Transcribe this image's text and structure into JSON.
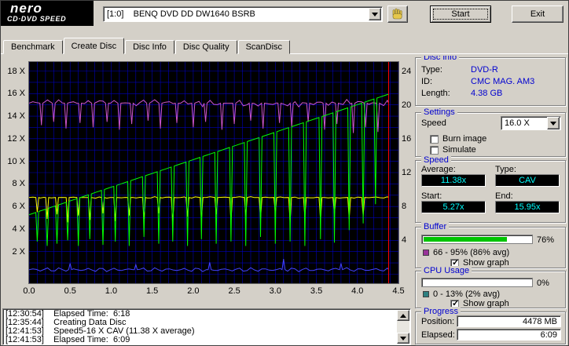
{
  "logo": {
    "brand": "nero",
    "product": "CD·DVD SPEED"
  },
  "toolbar": {
    "drive": "[1:0]    BENQ DVD DD DW1640 BSRB",
    "start": "Start",
    "exit": "Exit"
  },
  "tabs": [
    "Benchmark",
    "Create Disc",
    "Disc Info",
    "Disc Quality",
    "ScanDisc"
  ],
  "active_tab": "Create Disc",
  "disc_info": {
    "title": "Disc info",
    "rows": [
      {
        "label": "Type:",
        "value": "DVD-R"
      },
      {
        "label": "ID:",
        "value": "CMC MAG. AM3"
      },
      {
        "label": "Length:",
        "value": "4.38 GB"
      }
    ]
  },
  "settings": {
    "title": "Settings",
    "speed_label": "Speed",
    "speed_value": "16.0 X",
    "burn_image_label": "Burn image",
    "burn_image_checked": false,
    "simulate_label": "Simulate",
    "simulate_checked": false
  },
  "speed": {
    "title": "Speed",
    "average_label": "Average:",
    "average": "11.38x",
    "type_label": "Type:",
    "type": "CAV",
    "start_label": "Start:",
    "start": "5.27x",
    "end_label": "End:",
    "end": "15.95x"
  },
  "buffer": {
    "title": "Buffer",
    "value_label": "76%",
    "fill_percent": 76,
    "bar_color": "#00c400",
    "legend_color": "#993399",
    "range_label": "66 - 95% (86% avg)",
    "show_graph_label": "Show graph",
    "show_graph_checked": true
  },
  "cpu_usage": {
    "title": "CPU Usage",
    "value_label": "0%",
    "fill_percent": 0,
    "bar_color": "#00c400",
    "legend_color": "#2e8080",
    "range_label": "0 - 13% (2% avg)",
    "show_graph_label": "Show graph",
    "show_graph_checked": true
  },
  "progress": {
    "title": "Progress",
    "position_label": "Position:",
    "position": "4478 MB",
    "elapsed_label": "Elapsed:",
    "elapsed": "6:09"
  },
  "log": {
    "lines": [
      "[12:30:54]    Elapsed Time:  6:18",
      "[12:35:44]    Creating Data Disc",
      "[12:41:53]    Speed5-16 X CAV (11.38 X average)",
      "[12:41:53]    Elapsed Time:  6:09"
    ]
  },
  "chart_data": {
    "type": "line",
    "background": "#000000",
    "grid_color": "#0000bb",
    "marker_color": "#ff0000",
    "position_marker_x": 4.38,
    "x_axis": {
      "min": 0,
      "max": 4.5,
      "grid_step": 0.1,
      "ticks": [
        {
          "v": 0,
          "label": "0.0"
        },
        {
          "v": 0.5,
          "label": "0.5"
        },
        {
          "v": 1,
          "label": "1.0"
        },
        {
          "v": 1.5,
          "label": "1.5"
        },
        {
          "v": 2,
          "label": "2.0"
        },
        {
          "v": 2.5,
          "label": "2.5"
        },
        {
          "v": 3,
          "label": "3.0"
        },
        {
          "v": 3.5,
          "label": "3.5"
        },
        {
          "v": 4,
          "label": "4.0"
        },
        {
          "v": 4.5,
          "label": "4.5"
        }
      ]
    },
    "y_left": {
      "min": -0.8,
      "max": 18.8,
      "grid_step": 1,
      "grid_min": 0,
      "grid_max": 18,
      "ticks": [
        {
          "v": 2,
          "label": "2 X"
        },
        {
          "v": 4,
          "label": "4 X"
        },
        {
          "v": 6,
          "label": "6 X"
        },
        {
          "v": 8,
          "label": "8 X"
        },
        {
          "v": 10,
          "label": "10 X"
        },
        {
          "v": 12,
          "label": "12 X"
        },
        {
          "v": 14,
          "label": "14 X"
        },
        {
          "v": 16,
          "label": "16 X"
        },
        {
          "v": 18,
          "label": "18 X"
        }
      ]
    },
    "y_right": {
      "min": -1.07,
      "max": 25.07,
      "ticks": [
        {
          "v": 4,
          "label": "4"
        },
        {
          "v": 8,
          "label": "8"
        },
        {
          "v": 12,
          "label": "12"
        },
        {
          "v": 16,
          "label": "16"
        },
        {
          "v": 20,
          "label": "20"
        },
        {
          "v": 24,
          "label": "24"
        }
      ]
    },
    "series": [
      {
        "name": "buffer-level",
        "color": "#cc55cc",
        "kind": "flat",
        "x_start": 0,
        "x_end": 4.38,
        "y": 15.15,
        "noise": 0.22,
        "spikes": [
          [
            0.15,
            13.2
          ],
          [
            0.3,
            13.5
          ],
          [
            0.45,
            12.9
          ],
          [
            0.62,
            13.4
          ],
          [
            0.78,
            13.0
          ],
          [
            0.95,
            13.5
          ],
          [
            1.1,
            12.8
          ],
          [
            1.25,
            13.3
          ],
          [
            1.45,
            13.6
          ],
          [
            1.6,
            12.9
          ],
          [
            1.8,
            13.4
          ],
          [
            2.0,
            13.0
          ],
          [
            2.15,
            13.5
          ],
          [
            2.35,
            12.8
          ],
          [
            2.5,
            13.3
          ],
          [
            2.7,
            13.6
          ],
          [
            2.85,
            12.9
          ],
          [
            3.05,
            13.4
          ],
          [
            3.2,
            13.0
          ],
          [
            3.4,
            13.5
          ],
          [
            3.6,
            12.8
          ],
          [
            3.75,
            13.3
          ],
          [
            3.95,
            12.5
          ],
          [
            4.1,
            13.0
          ],
          [
            4.25,
            12.6
          ]
        ]
      },
      {
        "name": "cpu-usage",
        "color": "#4444ff",
        "kind": "flat",
        "x_start": 0,
        "x_end": 4.38,
        "y": 0.4,
        "noise": 0.12,
        "spikes": [
          [
            0.5,
            0.95
          ],
          [
            1.3,
            0.85
          ],
          [
            2.2,
            1.05
          ],
          [
            3.1,
            1.35
          ],
          [
            3.8,
            0.95
          ]
        ]
      },
      {
        "name": "read-reference",
        "color": "#ffff00",
        "kind": "flat",
        "x_start": 0,
        "x_end": 4.38,
        "y": 6.8,
        "noise": 0.05,
        "spikes": [
          [
            0.1,
            5.5
          ],
          [
            0.22,
            4.9
          ],
          [
            0.34,
            5.3
          ],
          [
            0.47,
            4.6
          ],
          [
            0.6,
            5.2
          ],
          [
            0.74,
            4.8
          ],
          [
            0.9,
            5.4
          ],
          [
            1.05,
            4.7
          ],
          [
            1.22,
            5.2
          ],
          [
            1.4,
            4.9
          ],
          [
            1.58,
            5.4
          ],
          [
            1.75,
            4.6
          ],
          [
            1.93,
            5.1
          ],
          [
            2.1,
            4.8
          ],
          [
            2.28,
            5.3
          ],
          [
            2.46,
            4.7
          ],
          [
            2.64,
            5.2
          ],
          [
            2.82,
            4.9
          ],
          [
            3.0,
            5.4
          ],
          [
            3.18,
            4.6
          ],
          [
            3.36,
            5.1
          ],
          [
            3.55,
            4.8
          ],
          [
            3.72,
            5.3
          ],
          [
            3.9,
            4.9
          ],
          [
            4.07,
            5.2
          ]
        ]
      },
      {
        "name": "write-speed",
        "color": "#00ff00",
        "kind": "ramp",
        "x_start": 0,
        "x_end": 4.38,
        "y_start": 5.27,
        "y_end": 15.95,
        "spikes": [
          [
            0.1,
            2.9
          ],
          [
            0.22,
            2.5
          ],
          [
            0.34,
            2.7
          ],
          [
            0.47,
            3.0
          ],
          [
            0.6,
            2.5
          ],
          [
            0.74,
            3.1
          ],
          [
            0.9,
            2.6
          ],
          [
            1.05,
            2.9
          ],
          [
            1.22,
            2.5
          ],
          [
            1.4,
            3.3
          ],
          [
            1.58,
            2.7
          ],
          [
            1.75,
            2.9
          ],
          [
            1.93,
            2.5
          ],
          [
            2.1,
            3.1
          ],
          [
            2.28,
            2.7
          ],
          [
            2.46,
            2.9
          ],
          [
            2.64,
            2.5
          ],
          [
            2.82,
            3.3
          ],
          [
            3.0,
            2.7
          ],
          [
            3.18,
            2.9
          ],
          [
            3.36,
            2.5
          ],
          [
            3.55,
            3.1
          ],
          [
            3.72,
            2.8
          ],
          [
            3.9,
            3.9
          ],
          [
            4.07,
            4.5
          ],
          [
            4.22,
            6.2
          ]
        ]
      }
    ]
  }
}
